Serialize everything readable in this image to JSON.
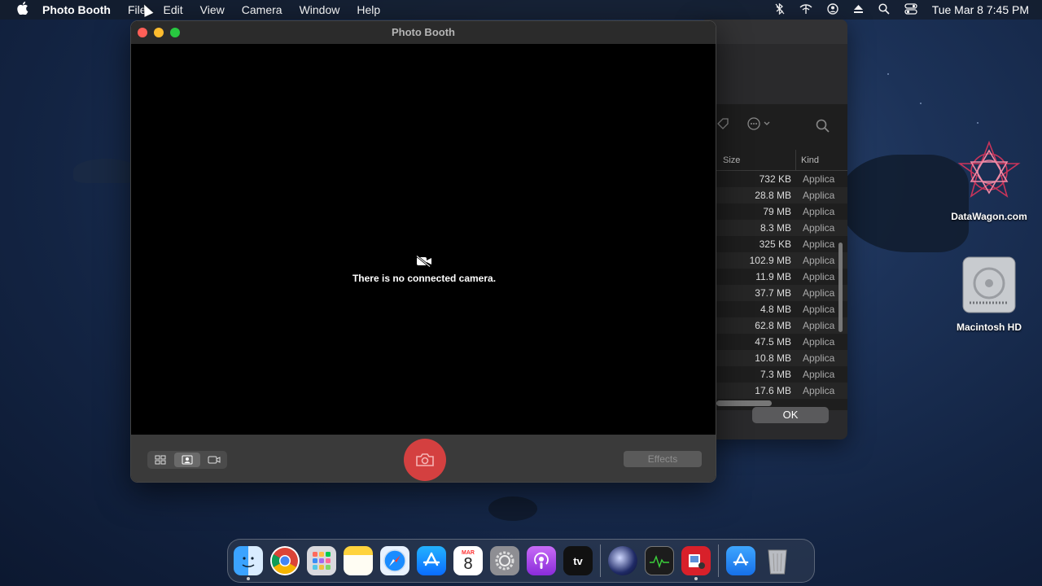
{
  "menubar": {
    "app_name": "Photo Booth",
    "menus": [
      "File",
      "Edit",
      "View",
      "Camera",
      "Window",
      "Help"
    ],
    "clock": "Tue Mar 8  7:45 PM"
  },
  "photo_booth": {
    "title": "Photo Booth",
    "message": "There is no connected camera.",
    "effects_label": "Effects"
  },
  "background_window": {
    "columns": {
      "size": "Size",
      "kind": "Kind"
    },
    "rows": [
      {
        "size": "732 KB",
        "kind": "Applica"
      },
      {
        "size": "28.8 MB",
        "kind": "Applica"
      },
      {
        "size": "79 MB",
        "kind": "Applica"
      },
      {
        "size": "8.3 MB",
        "kind": "Applica"
      },
      {
        "size": "325 KB",
        "kind": "Applica"
      },
      {
        "size": "102.9 MB",
        "kind": "Applica"
      },
      {
        "size": "11.9 MB",
        "kind": "Applica"
      },
      {
        "size": "37.7 MB",
        "kind": "Applica"
      },
      {
        "size": "4.8 MB",
        "kind": "Applica"
      },
      {
        "size": "62.8 MB",
        "kind": "Applica"
      },
      {
        "size": "47.5 MB",
        "kind": "Applica"
      },
      {
        "size": "10.8 MB",
        "kind": "Applica"
      },
      {
        "size": "7.3 MB",
        "kind": "Applica"
      },
      {
        "size": "17.6 MB",
        "kind": "Applica"
      }
    ],
    "ok_label": "OK"
  },
  "desktop": {
    "icons": [
      {
        "label": "DataWagon.com",
        "icon": "datawagon-logo"
      },
      {
        "label": "Macintosh HD",
        "icon": "hard-drive-icon"
      }
    ]
  },
  "dock": {
    "calendar_month": "MAR",
    "calendar_day": "8",
    "tv_label": "tv",
    "items": [
      "finder",
      "chrome",
      "launchpad",
      "notes",
      "safari",
      "app-store",
      "calendar",
      "system-preferences",
      "podcasts",
      "apple-tv",
      "cinema4d",
      "activity-monitor",
      "photo-booth",
      "app-store-folder",
      "trash"
    ]
  },
  "colors": {
    "shutter": "#d44040",
    "close": "#ff5f57",
    "minimize": "#febc2e",
    "zoom": "#28c840"
  }
}
